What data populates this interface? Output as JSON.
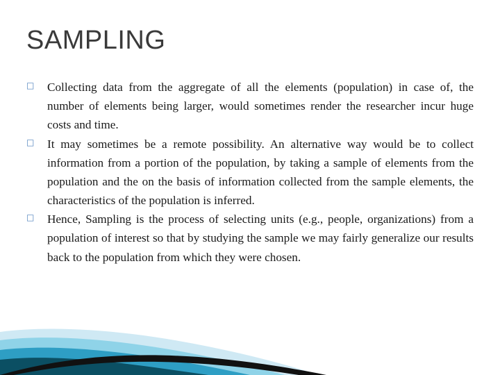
{
  "slide": {
    "title": "SAMPLING",
    "bullet_marker": "□",
    "bullets": [
      "Collecting data from the aggregate of all the elements (population) in case of, the number of elements being larger, would sometimes render the researcher incur huge costs and time.",
      "It may sometimes be a remote possibility. An alternative way would be to collect information from a portion of the population, by taking a sample of elements from the population and the on the basis of information collected from the sample elements, the characteristics of the population is inferred.",
      "Hence, Sampling is the process of selecting units (e.g., people, organizations) from a population of interest so that by studying the sample we may fairly generalize our results back to the population from which they were chosen."
    ]
  },
  "decoration": {
    "name": "bottom-left-wave-graphic",
    "colors": {
      "dark_teal": "#0b4f63",
      "mid_blue": "#2e9ec4",
      "light_blue": "#8fd3e8",
      "pale_blue": "#cfe9f4",
      "black": "#111111"
    }
  }
}
